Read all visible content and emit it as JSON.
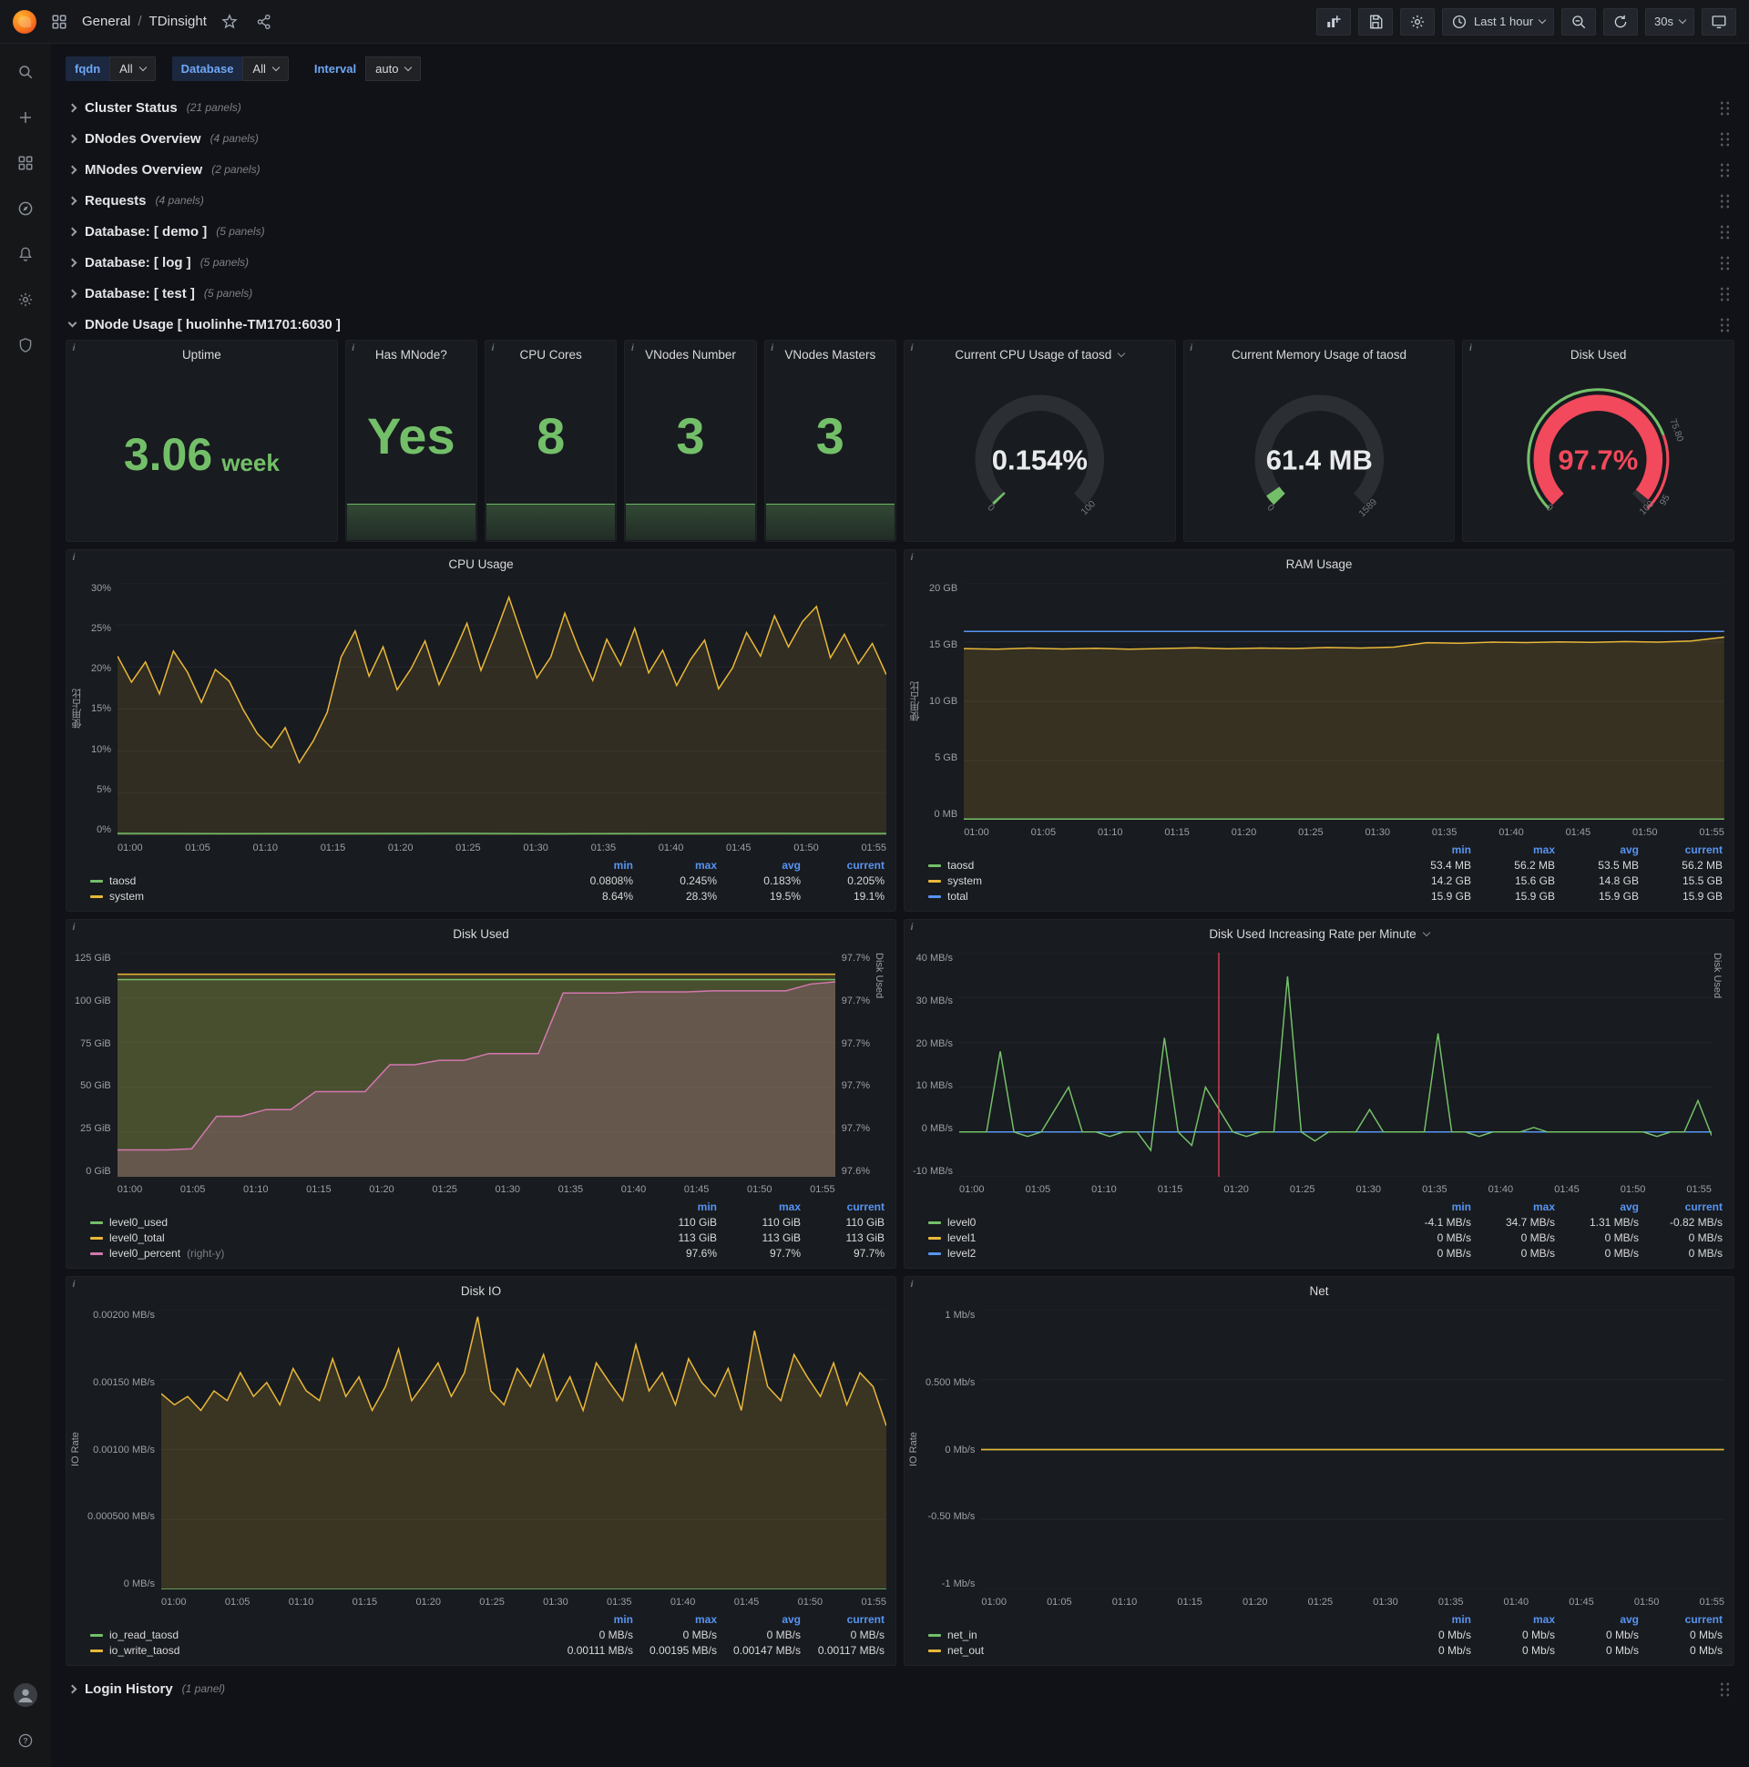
{
  "nav": {
    "breadcrumb": {
      "section": "General",
      "separator": "/",
      "page": "TDinsight"
    },
    "time_range": "Last 1 hour",
    "refresh_interval": "30s"
  },
  "sidebar": {
    "icons": [
      "search",
      "create",
      "dashboards",
      "explore",
      "alerting",
      "configuration",
      "server-admin",
      "user-avatar",
      "help"
    ]
  },
  "variables": [
    {
      "label": "fqdn",
      "value": "All"
    },
    {
      "label": "Database",
      "value": "All"
    },
    {
      "label": "Interval",
      "value": "auto"
    }
  ],
  "rows": [
    {
      "title": "Cluster Status",
      "count": "(21 panels)"
    },
    {
      "title": "DNodes Overview",
      "count": "(4 panels)"
    },
    {
      "title": "MNodes Overview",
      "count": "(2 panels)"
    },
    {
      "title": "Requests",
      "count": "(4 panels)"
    },
    {
      "title": "Database: [ demo ]",
      "count": "(5 panels)"
    },
    {
      "title": "Database: [ log ]",
      "count": "(5 panels)"
    },
    {
      "title": "Database: [ test ]",
      "count": "(5 panels)"
    }
  ],
  "expanded_row": {
    "title": "DNode Usage [ huolinhe-TM1701:6030 ]"
  },
  "bottom_row": {
    "title": "Login History",
    "count": "(1 panel)"
  },
  "misc": {
    "info_icon": "i"
  },
  "stats": [
    {
      "title": "Uptime",
      "value": "3.06",
      "unit": "week"
    },
    {
      "title": "Has MNode?",
      "value": "Yes"
    },
    {
      "title": "CPU Cores",
      "value": "8"
    },
    {
      "title": "VNodes Number",
      "value": "3"
    },
    {
      "title": "VNodes Masters",
      "value": "3"
    }
  ],
  "gauges": [
    {
      "title": "Current CPU Usage of taosd",
      "value": "0.154%",
      "percent": 0.154,
      "min_label": "0",
      "max_label": "100",
      "color": "#73bf69",
      "value_color": "#e9eaeb"
    },
    {
      "title": "Current Memory Usage of taosd",
      "value": "61.4 MB",
      "percent": 3.86,
      "min_label": "0",
      "max_label": "1589",
      "color": "#73bf69",
      "value_color": "#e9eaeb"
    },
    {
      "title": "Disk Used",
      "value": "97.7%",
      "percent": 97.7,
      "min_label": "0",
      "max_label": "100",
      "color": "#f2495c",
      "value_color": "#f2495c",
      "band": [
        {
          "from": 0,
          "to": 75.8,
          "color": "#73bf69"
        },
        {
          "from": 75.8,
          "to": 100,
          "color": "#f2495c"
        }
      ],
      "thresholds": [
        {
          "pos": 75.8,
          "label": "75.80"
        },
        {
          "pos": 95,
          "label": "95"
        }
      ]
    }
  ],
  "charts": {
    "cpu": {
      "type": "line",
      "title": "CPU Usage",
      "ylabel": "使用占比",
      "ymin": 0,
      "ymax": 30,
      "yticks": [
        "0%",
        "5%",
        "10%",
        "15%",
        "20%",
        "25%",
        "30%"
      ],
      "xticks": [
        "01:00",
        "01:05",
        "01:10",
        "01:15",
        "01:20",
        "01:25",
        "01:30",
        "01:35",
        "01:40",
        "01:45",
        "01:50",
        "01:55"
      ],
      "series": [
        {
          "name": "system",
          "color": "#eab839",
          "fill": true,
          "fill_opacity": 0.12,
          "points": [
            21.3,
            18.2,
            20.6,
            16.8,
            21.9,
            19.4,
            15.8,
            19.7,
            18.3,
            14.9,
            12.1,
            10.4,
            12.8,
            8.64,
            11.2,
            14.6,
            21.2,
            24.3,
            18.9,
            22.4,
            17.3,
            19.8,
            23.1,
            17.9,
            21.4,
            25.2,
            19.6,
            23.8,
            28.3,
            23.4,
            18.7,
            21.2,
            26.4,
            22.1,
            18.4,
            23.3,
            20.2,
            24.6,
            19.3,
            22.0,
            17.8,
            20.9,
            23.2,
            17.4,
            19.9,
            24.1,
            21.3,
            26.1,
            22.4,
            25.4,
            27.2,
            21.1,
            23.9,
            20.4,
            22.8,
            19.1
          ]
        },
        {
          "name": "taosd",
          "color": "#73bf69",
          "fill": true,
          "fill_opacity": 0.1,
          "points": [
            0.21,
            0.19,
            0.2,
            0.22,
            0.18,
            0.2,
            0.21,
            0.2
          ]
        }
      ],
      "legend": {
        "columns": [
          "min",
          "max",
          "avg",
          "current"
        ],
        "rows": [
          {
            "name": "taosd",
            "color": "#73bf69",
            "values": [
              "0.0808%",
              "0.245%",
              "0.183%",
              "0.205%"
            ]
          },
          {
            "name": "system",
            "color": "#eab839",
            "values": [
              "8.64%",
              "28.3%",
              "19.5%",
              "19.1%"
            ]
          }
        ]
      }
    },
    "ram": {
      "type": "line",
      "title": "RAM Usage",
      "ylabel": "使用占比",
      "ymin": 0,
      "ymax": 20,
      "yticks": [
        "0 MB",
        "5 GB",
        "10 GB",
        "15 GB",
        "20 GB"
      ],
      "xticks": [
        "01:00",
        "01:05",
        "01:10",
        "01:15",
        "01:20",
        "01:25",
        "01:30",
        "01:35",
        "01:40",
        "01:45",
        "01:50",
        "01:55"
      ],
      "series": [
        {
          "name": "system",
          "color": "#eab839",
          "fill": true,
          "fill_opacity": 0.15,
          "points": [
            14.45,
            14.4,
            14.5,
            14.42,
            14.48,
            14.4,
            14.46,
            14.52,
            14.44,
            14.5,
            14.46,
            14.55,
            14.5,
            14.58,
            14.95,
            14.9,
            15.0,
            14.96,
            15.02,
            14.98,
            15.05,
            15.0,
            15.1,
            15.42
          ]
        },
        {
          "name": "total",
          "color": "#5794f2",
          "fill": false,
          "points": [
            15.9,
            15.9
          ]
        },
        {
          "name": "taosd",
          "color": "#73bf69",
          "fill": true,
          "fill_opacity": 0.1,
          "points": [
            0.054,
            0.054
          ]
        }
      ],
      "legend": {
        "columns": [
          "min",
          "max",
          "avg",
          "current"
        ],
        "rows": [
          {
            "name": "taosd",
            "color": "#73bf69",
            "values": [
              "53.4 MB",
              "56.2 MB",
              "53.5 MB",
              "56.2 MB"
            ]
          },
          {
            "name": "system",
            "color": "#eab839",
            "values": [
              "14.2 GB",
              "15.6 GB",
              "14.8 GB",
              "15.5 GB"
            ]
          },
          {
            "name": "total",
            "color": "#5794f2",
            "values": [
              "15.9 GB",
              "15.9 GB",
              "15.9 GB",
              "15.9 GB"
            ]
          }
        ]
      }
    },
    "disk": {
      "type": "line",
      "title": "Disk Used",
      "ymin": 0,
      "ymax": 125,
      "yticks": [
        "0 GiB",
        "25 GiB",
        "50 GiB",
        "75 GiB",
        "100 GiB",
        "125 GiB"
      ],
      "yticks_right": [
        "97.6%",
        "97.7%",
        "97.7%",
        "97.7%",
        "97.7%",
        "97.7%"
      ],
      "ylabel_right": "Disk Used",
      "xticks": [
        "01:00",
        "01:05",
        "01:10",
        "01:15",
        "01:20",
        "01:25",
        "01:30",
        "01:35",
        "01:40",
        "01:45",
        "01:50",
        "01:55"
      ],
      "series": [
        {
          "name": "level0_total",
          "color": "#eab839",
          "fill": true,
          "fill_opacity": 0.18,
          "points": [
            113,
            113
          ]
        },
        {
          "name": "level0_used",
          "color": "#73bf69",
          "fill": true,
          "fill_opacity": 0.18,
          "points": [
            110,
            110
          ]
        },
        {
          "name": "level0_percent",
          "color": "#d377b0",
          "fill": true,
          "fill_opacity": 0.22,
          "ymin": 0,
          "ymax": 1,
          "points": [
            0.12,
            0.12,
            0.12,
            0.125,
            0.27,
            0.27,
            0.3,
            0.3,
            0.38,
            0.38,
            0.38,
            0.5,
            0.5,
            0.52,
            0.52,
            0.55,
            0.55,
            0.55,
            0.82,
            0.82,
            0.82,
            0.825,
            0.825,
            0.825,
            0.83,
            0.83,
            0.83,
            0.83,
            0.86,
            0.87
          ]
        }
      ],
      "legend": {
        "columns": [
          "min",
          "max",
          "current"
        ],
        "rows": [
          {
            "name": "level0_used",
            "color": "#73bf69",
            "values": [
              "110 GiB",
              "110 GiB",
              "110 GiB"
            ]
          },
          {
            "name": "level0_total",
            "color": "#eab839",
            "values": [
              "113 GiB",
              "113 GiB",
              "113 GiB"
            ]
          },
          {
            "name": "level0_percent",
            "color": "#d377b0",
            "suffix": "(right-y)",
            "values": [
              "97.6%",
              "97.7%",
              "97.7%"
            ]
          }
        ]
      }
    },
    "diskrate": {
      "type": "line",
      "title": "Disk Used Increasing Rate per Minute",
      "ymin": -10,
      "ymax": 40,
      "yticks": [
        "-10 MB/s",
        "0 MB/s",
        "10 MB/s",
        "20 MB/s",
        "30 MB/s",
        "40 MB/s"
      ],
      "ylabel_right": "Disk Used",
      "annotation_x": 0.345,
      "xticks": [
        "01:00",
        "01:05",
        "01:10",
        "01:15",
        "01:20",
        "01:25",
        "01:30",
        "01:35",
        "01:40",
        "01:45",
        "01:50",
        "01:55"
      ],
      "series": [
        {
          "name": "level1",
          "color": "#eab839",
          "fill": false,
          "points": [
            0,
            0
          ]
        },
        {
          "name": "level2",
          "color": "#5794f2",
          "fill": false,
          "points": [
            0,
            0
          ]
        },
        {
          "name": "level0",
          "color": "#73bf69",
          "fill": false,
          "points": [
            0,
            0,
            0,
            18,
            0,
            -1,
            0,
            5,
            10,
            0,
            0,
            -1,
            0,
            0,
            -4.1,
            21,
            0,
            -3,
            10,
            5,
            0,
            -1,
            0,
            0,
            34.7,
            0,
            -2,
            0,
            0,
            0,
            5,
            0,
            0,
            0,
            0,
            22,
            0,
            0,
            -1,
            0,
            0,
            0,
            1,
            0,
            0,
            0,
            0,
            0,
            0,
            0,
            0,
            -1,
            0,
            0,
            7,
            -0.8
          ]
        }
      ],
      "legend": {
        "columns": [
          "min",
          "max",
          "avg",
          "current"
        ],
        "rows": [
          {
            "name": "level0",
            "color": "#73bf69",
            "values": [
              "-4.1 MB/s",
              "34.7 MB/s",
              "1.31 MB/s",
              "-0.82 MB/s"
            ]
          },
          {
            "name": "level1",
            "color": "#eab839",
            "values": [
              "0 MB/s",
              "0 MB/s",
              "0 MB/s",
              "0 MB/s"
            ]
          },
          {
            "name": "level2",
            "color": "#5794f2",
            "values": [
              "0 MB/s",
              "0 MB/s",
              "0 MB/s",
              "0 MB/s"
            ]
          }
        ]
      }
    },
    "diskio": {
      "type": "line",
      "title": "Disk IO",
      "ylabel": "IO Rate",
      "ymin": 0,
      "ymax": 0.002,
      "yticks": [
        "0 MB/s",
        "0.000500 MB/s",
        "0.00100 MB/s",
        "0.00150 MB/s",
        "0.00200 MB/s"
      ],
      "xticks": [
        "01:00",
        "01:05",
        "01:10",
        "01:15",
        "01:20",
        "01:25",
        "01:30",
        "01:35",
        "01:40",
        "01:45",
        "01:50",
        "01:55"
      ],
      "series": [
        {
          "name": "io_write_taosd",
          "color": "#eab839",
          "fill": true,
          "fill_opacity": 0.16,
          "points": [
            0.0014,
            0.00132,
            0.00138,
            0.00128,
            0.00142,
            0.00135,
            0.00155,
            0.00138,
            0.00148,
            0.00132,
            0.00158,
            0.00142,
            0.00135,
            0.00165,
            0.00138,
            0.00152,
            0.00128,
            0.00145,
            0.00172,
            0.00135,
            0.00148,
            0.00162,
            0.00138,
            0.00155,
            0.00195,
            0.00142,
            0.00132,
            0.00158,
            0.00145,
            0.00168,
            0.00135,
            0.00152,
            0.00128,
            0.00162,
            0.00148,
            0.00135,
            0.00175,
            0.00142,
            0.00155,
            0.00132,
            0.00165,
            0.00148,
            0.00138,
            0.00158,
            0.00128,
            0.00185,
            0.00145,
            0.00135,
            0.00168,
            0.00152,
            0.00138,
            0.00162,
            0.00132,
            0.00155,
            0.00145,
            0.00117
          ]
        },
        {
          "name": "io_read_taosd",
          "color": "#73bf69",
          "fill": false,
          "points": [
            0,
            0
          ]
        }
      ],
      "legend": {
        "columns": [
          "min",
          "max",
          "avg",
          "current"
        ],
        "rows": [
          {
            "name": "io_read_taosd",
            "color": "#73bf69",
            "values": [
              "0 MB/s",
              "0 MB/s",
              "0 MB/s",
              "0 MB/s"
            ]
          },
          {
            "name": "io_write_taosd",
            "color": "#eab839",
            "values": [
              "0.00111 MB/s",
              "0.00195 MB/s",
              "0.00147 MB/s",
              "0.00117 MB/s"
            ]
          }
        ]
      }
    },
    "net": {
      "type": "line",
      "title": "Net",
      "ylabel": "IO Rate",
      "ymin": -1,
      "ymax": 1,
      "yticks": [
        "-1 Mb/s",
        "-0.50 Mb/s",
        "0 Mb/s",
        "0.500 Mb/s",
        "1 Mb/s"
      ],
      "xticks": [
        "01:00",
        "01:05",
        "01:10",
        "01:15",
        "01:20",
        "01:25",
        "01:30",
        "01:35",
        "01:40",
        "01:45",
        "01:50",
        "01:55"
      ],
      "series": [
        {
          "name": "net_in",
          "color": "#73bf69",
          "fill": false,
          "points": [
            0,
            0
          ]
        },
        {
          "name": "net_out",
          "color": "#eab839",
          "fill": false,
          "points": [
            0,
            0
          ]
        }
      ],
      "legend": {
        "columns": [
          "min",
          "max",
          "avg",
          "current"
        ],
        "rows": [
          {
            "name": "net_in",
            "color": "#73bf69",
            "values": [
              "0 Mb/s",
              "0 Mb/s",
              "0 Mb/s",
              "0 Mb/s"
            ]
          },
          {
            "name": "net_out",
            "color": "#eab839",
            "values": [
              "0 Mb/s",
              "0 Mb/s",
              "0 Mb/s",
              "0 Mb/s"
            ]
          }
        ]
      }
    }
  }
}
